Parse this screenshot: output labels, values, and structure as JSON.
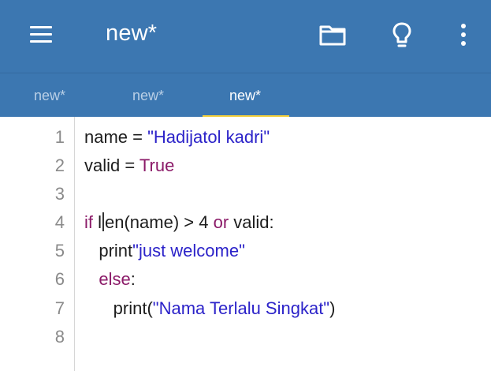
{
  "appbar": {
    "title": "new*",
    "icons": [
      "menu-icon",
      "folder-icon",
      "lightbulb-icon",
      "more-vertical-icon"
    ]
  },
  "tabs": [
    {
      "label": "new*",
      "active": false
    },
    {
      "label": "new*",
      "active": false
    },
    {
      "label": "new*",
      "active": true
    }
  ],
  "editor": {
    "lines": [
      {
        "num": "1",
        "tokens": [
          {
            "t": "name = ",
            "c": "plain"
          },
          {
            "t": "\"Hadijatol kadri\"",
            "c": "str"
          }
        ]
      },
      {
        "num": "2",
        "tokens": [
          {
            "t": "valid = ",
            "c": "plain"
          },
          {
            "t": "True",
            "c": "kw"
          }
        ]
      },
      {
        "num": "3",
        "tokens": []
      },
      {
        "num": "4",
        "tokens": [
          {
            "t": "if",
            "c": "kw"
          },
          {
            "t": " l",
            "c": "plain"
          },
          {
            "t": "en(name) > 4 ",
            "c": "plain"
          },
          {
            "t": "or",
            "c": "kw"
          },
          {
            "t": " valid:",
            "c": "plain"
          }
        ]
      },
      {
        "num": "5",
        "tokens": [
          {
            "t": "   print",
            "c": "plain"
          },
          {
            "t": "\"just welcome\"",
            "c": "str"
          }
        ]
      },
      {
        "num": "6",
        "tokens": [
          {
            "t": "   ",
            "c": "plain"
          },
          {
            "t": "else",
            "c": "kw"
          },
          {
            "t": ":",
            "c": "plain"
          }
        ]
      },
      {
        "num": "7",
        "tokens": [
          {
            "t": "      print(",
            "c": "plain"
          },
          {
            "t": "\"Nama Terlalu Singkat\"",
            "c": "str"
          },
          {
            "t": ")",
            "c": "plain"
          }
        ]
      },
      {
        "num": "8",
        "tokens": []
      }
    ]
  },
  "colors": {
    "appbar": "#3c77b1",
    "tab_indicator": "#f3cf3b",
    "string": "#2c23c9",
    "keyword": "#8b1a68"
  }
}
